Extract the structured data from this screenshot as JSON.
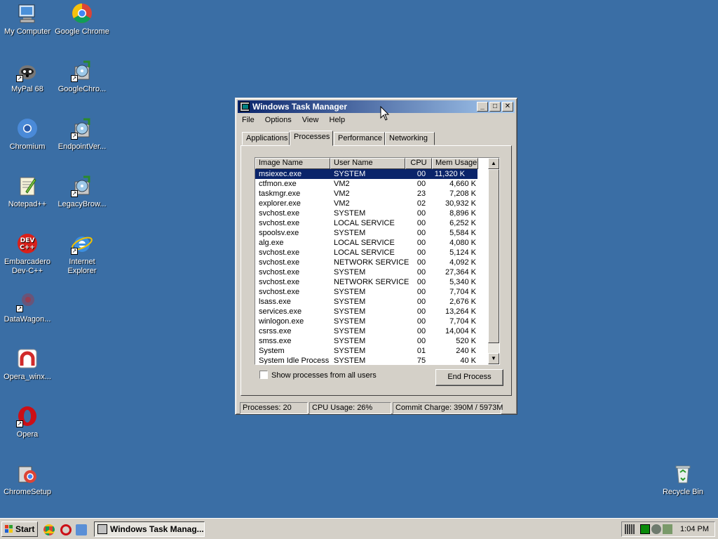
{
  "desktop": {
    "icons": [
      {
        "label": "My Computer",
        "icon": "my-computer-icon"
      },
      {
        "label": "Google Chrome",
        "icon": "chrome-icon"
      },
      {
        "label": "MyPal 68",
        "icon": "mypal-icon"
      },
      {
        "label": "GoogleChro...",
        "icon": "installer-icon"
      },
      {
        "label": "Chromium",
        "icon": "chromium-icon"
      },
      {
        "label": "EndpointVer...",
        "icon": "installer-icon"
      },
      {
        "label": "Notepad++",
        "icon": "notepad-plus-plus-icon"
      },
      {
        "label": "LegacyBrow...",
        "icon": "installer-icon"
      },
      {
        "label": "Embarcadero Dev-C++",
        "icon": "dev-cpp-icon"
      },
      {
        "label": "Internet Explorer",
        "icon": "internet-explorer-icon"
      },
      {
        "label": "DataWagon...",
        "icon": "datawagon-icon"
      },
      {
        "label": "Opera_winx...",
        "icon": "opera-installer-icon"
      },
      {
        "label": "Opera",
        "icon": "opera-icon"
      },
      {
        "label": "ChromeSetup",
        "icon": "chrome-setup-icon"
      },
      {
        "label": "Recycle Bin",
        "icon": "recycle-bin-icon"
      }
    ]
  },
  "window": {
    "title": "Windows Task Manager",
    "controls": {
      "minimize": "_",
      "maximize": "□",
      "close": "✕"
    },
    "menu": [
      "File",
      "Options",
      "View",
      "Help"
    ],
    "tabs": [
      "Applications",
      "Processes",
      "Performance",
      "Networking"
    ],
    "active_tab": "Processes",
    "columns": [
      "Image Name",
      "User Name",
      "CPU",
      "Mem Usage"
    ],
    "processes": [
      {
        "name": "msiexec.exe",
        "user": "SYSTEM",
        "cpu": "00",
        "mem": "11,320 K",
        "selected": true
      },
      {
        "name": "ctfmon.exe",
        "user": "VM2",
        "cpu": "00",
        "mem": "4,660 K"
      },
      {
        "name": "taskmgr.exe",
        "user": "VM2",
        "cpu": "23",
        "mem": "7,208 K"
      },
      {
        "name": "explorer.exe",
        "user": "VM2",
        "cpu": "02",
        "mem": "30,932 K"
      },
      {
        "name": "svchost.exe",
        "user": "SYSTEM",
        "cpu": "00",
        "mem": "8,896 K"
      },
      {
        "name": "svchost.exe",
        "user": "LOCAL SERVICE",
        "cpu": "00",
        "mem": "6,252 K"
      },
      {
        "name": "spoolsv.exe",
        "user": "SYSTEM",
        "cpu": "00",
        "mem": "5,584 K"
      },
      {
        "name": "alg.exe",
        "user": "LOCAL SERVICE",
        "cpu": "00",
        "mem": "4,080 K"
      },
      {
        "name": "svchost.exe",
        "user": "LOCAL SERVICE",
        "cpu": "00",
        "mem": "5,124 K"
      },
      {
        "name": "svchost.exe",
        "user": "NETWORK SERVICE",
        "cpu": "00",
        "mem": "4,092 K"
      },
      {
        "name": "svchost.exe",
        "user": "SYSTEM",
        "cpu": "00",
        "mem": "27,364 K"
      },
      {
        "name": "svchost.exe",
        "user": "NETWORK SERVICE",
        "cpu": "00",
        "mem": "5,340 K"
      },
      {
        "name": "svchost.exe",
        "user": "SYSTEM",
        "cpu": "00",
        "mem": "7,704 K"
      },
      {
        "name": "lsass.exe",
        "user": "SYSTEM",
        "cpu": "00",
        "mem": "2,676 K"
      },
      {
        "name": "services.exe",
        "user": "SYSTEM",
        "cpu": "00",
        "mem": "13,264 K"
      },
      {
        "name": "winlogon.exe",
        "user": "SYSTEM",
        "cpu": "00",
        "mem": "7,704 K"
      },
      {
        "name": "csrss.exe",
        "user": "SYSTEM",
        "cpu": "00",
        "mem": "14,004 K"
      },
      {
        "name": "smss.exe",
        "user": "SYSTEM",
        "cpu": "00",
        "mem": "520 K"
      },
      {
        "name": "System",
        "user": "SYSTEM",
        "cpu": "01",
        "mem": "240 K"
      },
      {
        "name": "System Idle Process",
        "user": "SYSTEM",
        "cpu": "75",
        "mem": "40 K"
      }
    ],
    "show_all_label": "Show processes from all users",
    "end_process_label": "End Process",
    "status": {
      "processes": "Processes: 20",
      "cpu": "CPU Usage: 26%",
      "commit": "Commit Charge: 390M / 5973M"
    }
  },
  "taskbar": {
    "start_label": "Start",
    "task_label": "Windows Task Manag...",
    "clock": "1:04 PM"
  }
}
